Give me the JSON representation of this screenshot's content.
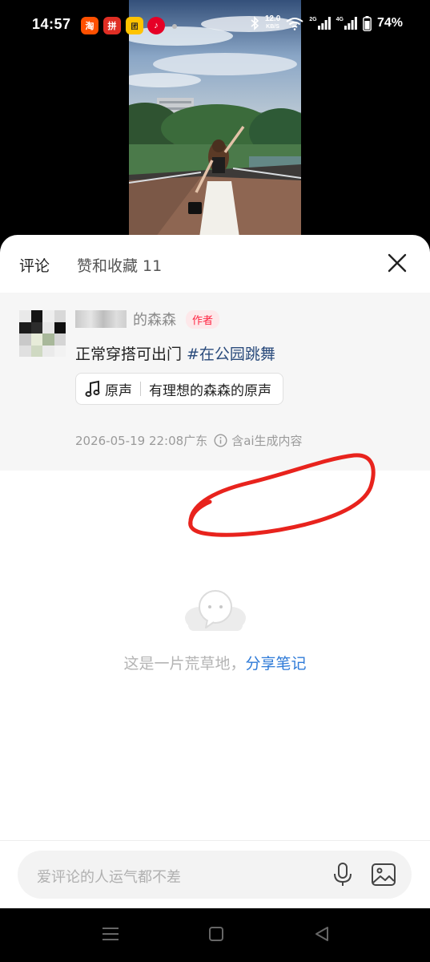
{
  "status_bar": {
    "time": "14:57",
    "apps": [
      {
        "name": "taobao",
        "glyph": "淘"
      },
      {
        "name": "pinduoduo",
        "glyph": "拼"
      },
      {
        "name": "meituan",
        "glyph": "团"
      },
      {
        "name": "netease-music",
        "glyph": "♪"
      }
    ],
    "net_speed_value": "12.0",
    "net_speed_unit": "KB/S",
    "sim1_tag": "2G",
    "sim2_tag": "4G",
    "battery": "74%"
  },
  "sheet": {
    "tabs": {
      "comments": "评论",
      "likes": "赞和收藏 11"
    },
    "note": {
      "author_name": "的森森",
      "author_badge": "作者",
      "text": "正常穿搭可出门",
      "hashtag": "#在公园跳舞",
      "music_label": "原声",
      "music_title": "有理想的森森的原声",
      "date": "2026-05-19 22:08",
      "location": "广东",
      "ai_notice": "含ai生成内容"
    },
    "empty_state": {
      "text": "这是一片荒草地，",
      "link": "分享笔记"
    },
    "input": {
      "placeholder": "爱评论的人运气都不差"
    }
  },
  "colors": {
    "accent_red": "#ff2442",
    "link_blue": "#2f7bd8",
    "hashtag_blue": "#2a4b7c",
    "annotation_red": "#e8231d"
  },
  "icons": [
    "bluetooth-icon",
    "wifi-icon",
    "signal-icon",
    "battery-icon",
    "close-icon",
    "music-note-icon",
    "info-icon",
    "chat-bubble-icon",
    "mic-icon",
    "image-icon",
    "menu-nav-icon",
    "home-nav-icon",
    "back-nav-icon"
  ]
}
